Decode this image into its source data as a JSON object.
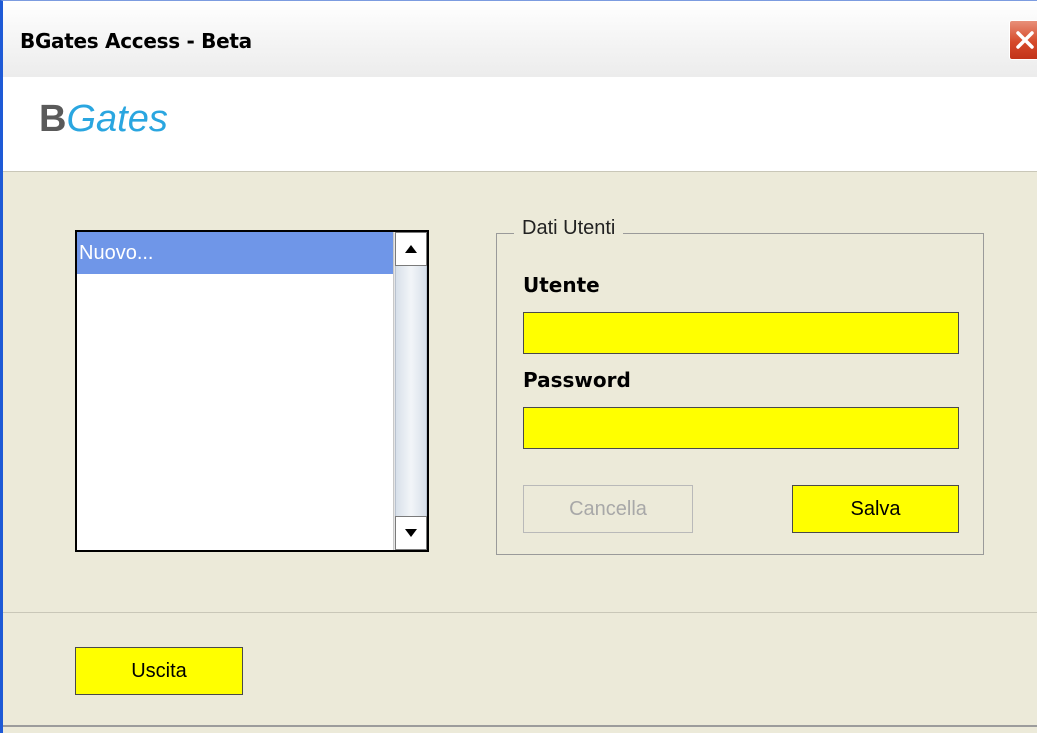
{
  "window": {
    "title": "BGates Access - Beta"
  },
  "logo": {
    "part1": "B",
    "part2": "Gates"
  },
  "user_list": {
    "items": [
      "Nuovo..."
    ]
  },
  "form": {
    "group_title": "Dati Utenti",
    "user_label": "Utente",
    "user_value": "",
    "password_label": "Password",
    "password_value": "",
    "cancel_label": "Cancella",
    "save_label": "Salva"
  },
  "footer": {
    "exit_label": "Uscita"
  },
  "colors": {
    "field_background": "#ffff00",
    "selection": "#6f96e8",
    "logo_accent": "#2aa6e0",
    "window_background": "#ecead9"
  }
}
